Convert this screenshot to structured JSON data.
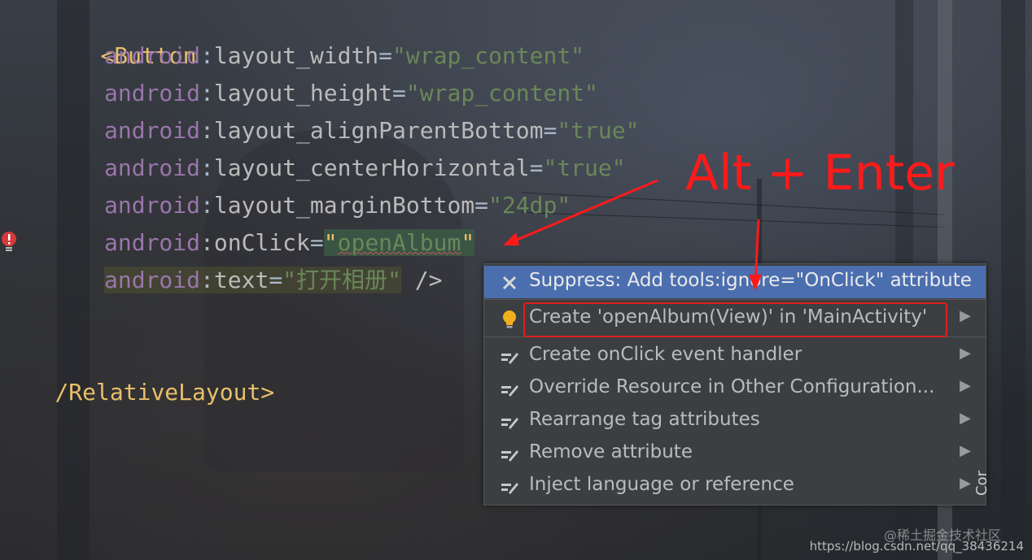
{
  "editor": {
    "lines": [
      {
        "tag": "<Button"
      },
      {
        "ns": "android",
        "attr": "layout_width",
        "val": "\"wrap_content\""
      },
      {
        "ns": "android",
        "attr": "layout_height",
        "val": "\"wrap_content\""
      },
      {
        "ns": "android",
        "attr": "layout_alignParentBottom",
        "val": "\"true\""
      },
      {
        "ns": "android",
        "attr": "layout_centerHorizontal",
        "val": "\"true\""
      },
      {
        "ns": "android",
        "attr": "layout_marginBottom",
        "val": "\"24dp\""
      },
      {
        "ns": "android",
        "attr": "onClick",
        "q1": "\"",
        "val": "openAlbum",
        "q2": "\""
      },
      {
        "ns": "android",
        "attr": "text",
        "val": "\"打开相册\"",
        "close": " />"
      },
      {
        "tag": "/RelativeLayout>"
      }
    ],
    "colon": ":",
    "equals": "="
  },
  "popup": {
    "items": [
      {
        "label": "Suppress: Add tools:ignore=\"OnClick\" attribute",
        "icon": "close-x-icon",
        "selected": true
      },
      {
        "label": "Create 'openAlbum(View)' in 'MainActivity'",
        "icon": "lightbulb-icon",
        "submenu": "▶"
      },
      {
        "label": "Create onClick event handler",
        "icon": "pencil-intention-icon",
        "submenu": "▶"
      },
      {
        "label": "Override Resource in Other Configuration...",
        "icon": "pencil-intention-icon",
        "submenu": "▶"
      },
      {
        "label": "Rearrange tag attributes",
        "icon": "pencil-intention-icon",
        "submenu": "▶"
      },
      {
        "label": "Remove attribute",
        "icon": "pencil-intention-icon",
        "submenu": "▶"
      },
      {
        "label": "Inject language or reference",
        "icon": "pencil-intention-icon",
        "submenu": "▶"
      }
    ]
  },
  "annotation": {
    "text": "Alt + Enter",
    "color": "#ff1a1a"
  },
  "watermark": {
    "text": "https://blog.csdn.net/qq_38436214",
    "site": "@稀土掘金技术社区"
  },
  "sidebar": {
    "text": "Cor"
  }
}
